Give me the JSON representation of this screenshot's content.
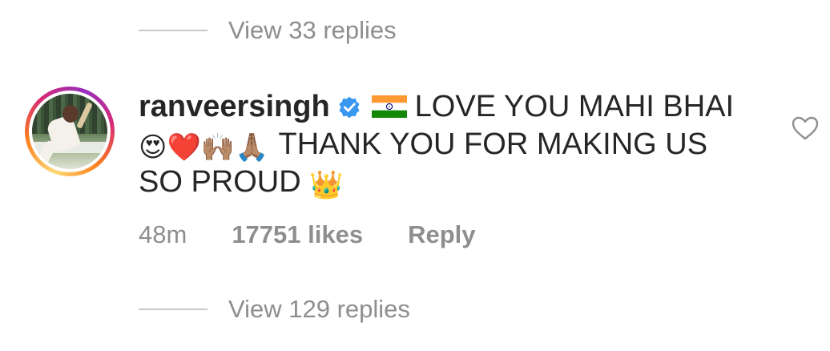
{
  "top_replies": {
    "label": "View 33 replies"
  },
  "comment": {
    "username": "ranveersingh",
    "verified": true,
    "line1_text": "LOVE YOU MAHI BHAI",
    "emojis": [
      "😍",
      "❤️",
      "🙌🏽",
      "🙏🏽"
    ],
    "line2_text": "THANK YOU FOR MAKING US",
    "line3_text": "SO PROUD",
    "end_emoji": "👑",
    "time": "48m",
    "likes": "17751 likes",
    "reply_label": "Reply"
  },
  "bottom_replies": {
    "label": "View 129 replies"
  },
  "colors": {
    "text": "#262626",
    "secondary": "#8e8e8e",
    "verified_blue": "#3897f0",
    "divider": "#c7c7c7"
  },
  "icons": {
    "verified": "verified-badge-icon",
    "flag": "india-flag-icon",
    "like": "heart-outline-icon"
  }
}
